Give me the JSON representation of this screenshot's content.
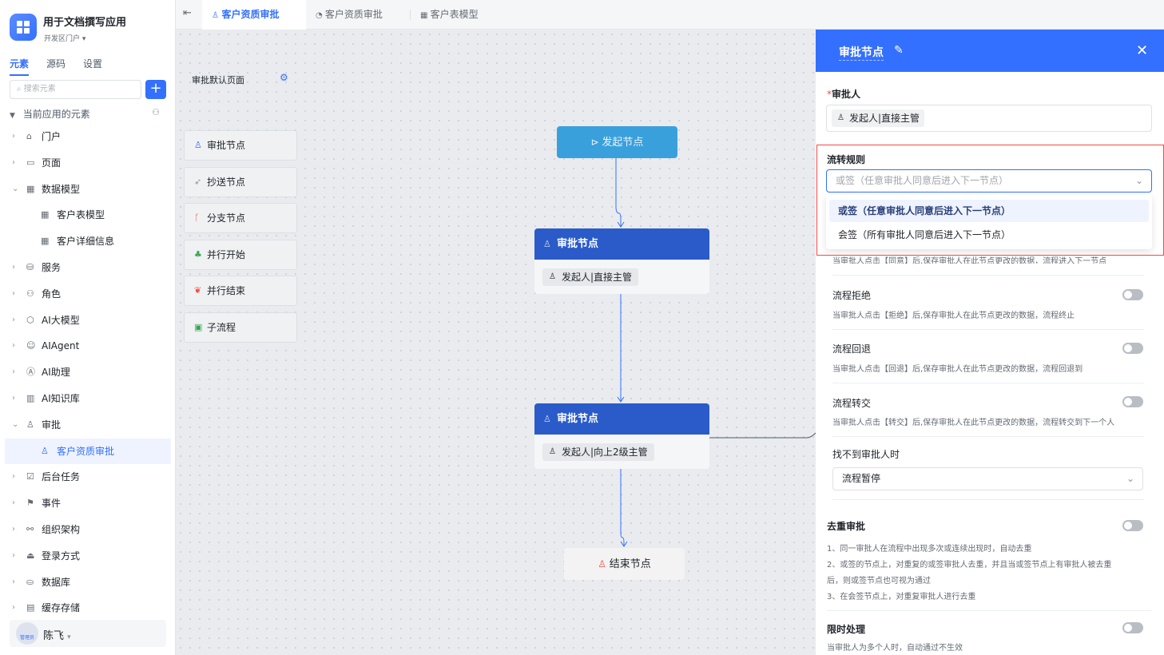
{
  "app": {
    "title": "用于文档撰写应用",
    "subtitle": "开发区门户 ▾"
  },
  "sidebar": {
    "tabs": [
      {
        "label": "元素"
      },
      {
        "label": "源码"
      },
      {
        "label": "设置"
      }
    ],
    "search_placeholder": "搜索元素",
    "section_title": "当前应用的元素",
    "items": [
      {
        "label": "门户",
        "icon": "home-icon"
      },
      {
        "label": "页面",
        "icon": "page-icon"
      },
      {
        "label": "数据模型",
        "icon": "table-icon"
      },
      {
        "label": "客户表模型",
        "icon": "table-icon"
      },
      {
        "label": "客户详细信息",
        "icon": "table-icon"
      },
      {
        "label": "服务",
        "icon": "service-icon"
      },
      {
        "label": "角色",
        "icon": "role-icon"
      },
      {
        "label": "AI大模型",
        "icon": "ai-model-icon"
      },
      {
        "label": "AIAgent",
        "icon": "robot-icon"
      },
      {
        "label": "AI助理",
        "icon": "ai-assistant-icon"
      },
      {
        "label": "AI知识库",
        "icon": "book-icon"
      },
      {
        "label": "审批",
        "icon": "approval-icon"
      },
      {
        "label": "客户资质审批",
        "icon": "approval-icon"
      },
      {
        "label": "后台任务",
        "icon": "task-icon"
      },
      {
        "label": "事件",
        "icon": "event-icon"
      },
      {
        "label": "组织架构",
        "icon": "org-icon"
      },
      {
        "label": "登录方式",
        "icon": "login-icon"
      },
      {
        "label": "数据库",
        "icon": "database-icon"
      },
      {
        "label": "缓存存储",
        "icon": "cache-icon"
      }
    ],
    "user": {
      "avatar_text": "管理员",
      "name": "陈飞"
    }
  },
  "tabs": [
    {
      "label": "客户资质审批"
    },
    {
      "label": "客户资质审批"
    },
    {
      "label": "客户表模型"
    }
  ],
  "palette": {
    "title": "审批默认页面",
    "items": [
      {
        "label": "审批节点",
        "color": "#3370ff"
      },
      {
        "label": "抄送节点",
        "color": "#8f959e"
      },
      {
        "label": "分支节点",
        "color": "#f54a45"
      },
      {
        "label": "并行开始",
        "color": "#34a853"
      },
      {
        "label": "并行结束",
        "color": "#f54a45"
      },
      {
        "label": "子流程",
        "color": "#34a853"
      }
    ]
  },
  "flow": {
    "start": "发起节点",
    "node1": {
      "title": "审批节点",
      "approver": "发起人|直接主管"
    },
    "node2": {
      "title": "审批节点",
      "approver": "发起人|向上2级主管"
    },
    "end": "结束节点"
  },
  "panel": {
    "title": "审批节点",
    "approver_label": "审批人",
    "approver_value": "发起人|直接主管",
    "rule_label": "流转规则",
    "rule_placeholder": "或签（任意审批人同意后进入下一节点）",
    "rule_options": [
      "或签（任意审批人同意后进入下一节点）",
      "会签（所有审批人同意后进入下一节点）"
    ],
    "agree_desc": "当审批人点击【同意】后,保存审批人在此节点更改的数据，流程进入下一节点",
    "reject": {
      "label": "流程拒绝",
      "desc": "当审批人点击【拒绝】后,保存审批人在此节点更改的数据，流程终止"
    },
    "rollback": {
      "label": "流程回退",
      "desc": "当审批人点击【回退】后,保存审批人在此节点更改的数据，流程回退到"
    },
    "transfer": {
      "label": "流程转交",
      "desc": "当审批人点击【转交】后,保存审批人在此节点更改的数据，流程转交到下一个人"
    },
    "notfound": {
      "label": "找不到审批人时",
      "value": "流程暂停"
    },
    "dedupe": {
      "label": "去重审批",
      "lines": [
        "1、同一审批人在流程中出现多次或连续出现时，自动去重",
        "2、或签的节点上，对重复的或签审批人去重，并且当或签节点上有审批人被去重",
        "后，则或签节点也可视为通过",
        "3、在会签节点上，对重复审批人进行去重"
      ]
    },
    "timelimit": {
      "label": "限时处理",
      "desc": "当审批人为多个人时，自动通过不生效"
    }
  }
}
